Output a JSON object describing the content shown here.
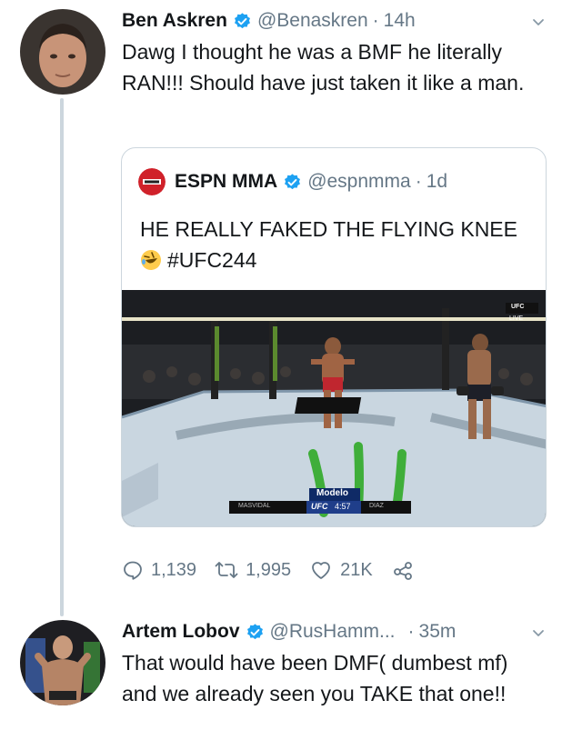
{
  "tweets": [
    {
      "author_name": "Ben Askren",
      "handle": "@Benaskren",
      "separator": "·",
      "time": "14h",
      "text": "Dawg I thought he was a BMF he literally RAN!!! Should have just taken it like a man.",
      "quoted": {
        "author_name": "ESPN MMA",
        "handle": "@espnmma",
        "separator": "·",
        "time": "1d",
        "text_line1": "HE REALLY FAKED THE FLYING KNEE",
        "hashtag": "#UFC244",
        "emoji": "rolling-on-floor-laughing",
        "video_overlay": {
          "sponsor": "Modelo",
          "corner_badge": "UFC",
          "corner_live": "LIVE",
          "league": "UFC",
          "clock": "4:57",
          "left_fighter": "MASVIDAL",
          "right_fighter": "DIAZ"
        }
      },
      "stats": {
        "replies": "1,139",
        "retweets": "1,995",
        "likes": "21K"
      }
    },
    {
      "author_name": "Artem Lobov",
      "handle": "@RusHamm...",
      "separator": "·",
      "time": "35m",
      "text": "That would have been DMF( dumbest mf) and we already seen you TAKE that one!!"
    }
  ],
  "colors": {
    "verified": "#1da1f2",
    "secondary_text": "#657786",
    "border": "#ccd6dd",
    "espn_red": "#d0212a"
  }
}
